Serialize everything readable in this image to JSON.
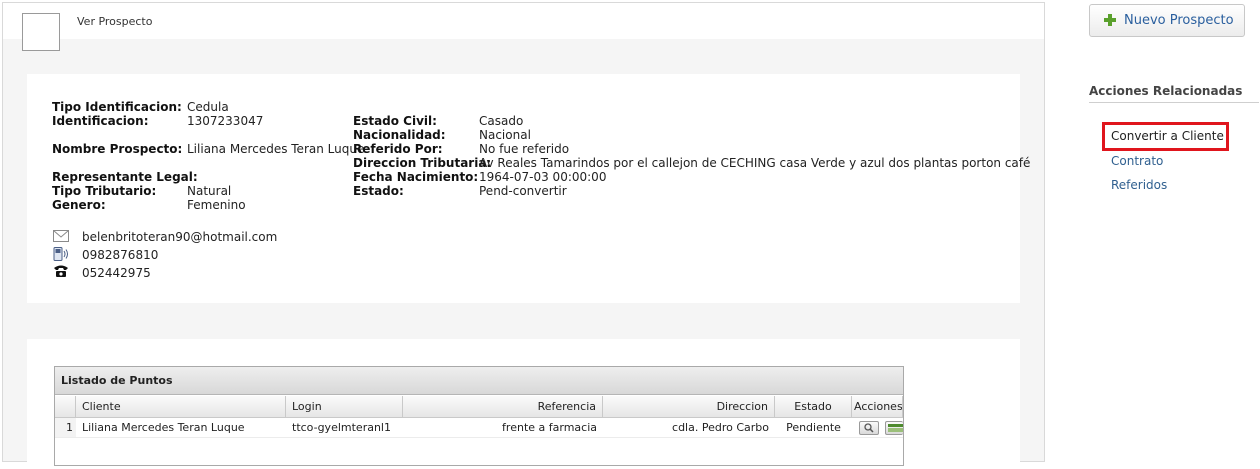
{
  "header": {
    "title": "Ver Prospecto"
  },
  "prospect": {
    "left_fields": [
      {
        "label": "Tipo Identificacion:",
        "value": "Cedula"
      },
      {
        "label": "Identificacion:",
        "value": "1307233047"
      },
      {
        "label": "Nombre Prospecto:",
        "value": "Liliana Mercedes Teran Luque"
      },
      {
        "label": "Representante Legal:",
        "value": ""
      },
      {
        "label": "Tipo Tributario:",
        "value": "Natural"
      },
      {
        "label": "Genero:",
        "value": "Femenino"
      }
    ],
    "right_fields": [
      {
        "label": "Estado Civil:",
        "value": "Casado"
      },
      {
        "label": "Nacionalidad:",
        "value": "Nacional"
      },
      {
        "label": "Referido Por:",
        "value": "No fue referido"
      },
      {
        "label": "Direccion Tributaria:",
        "value": "Av Reales Tamarindos por el callejon de CECHING casa Verde y azul dos plantas porton café"
      },
      {
        "label": "Fecha Nacimiento:",
        "value": "1964-07-03 00:00:00"
      },
      {
        "label": "Estado:",
        "value": "Pend-convertir"
      }
    ],
    "contacts": {
      "email": "belenbritoteran90@hotmail.com",
      "mobile": "0982876810",
      "phone": "052442975"
    }
  },
  "grid": {
    "title": "Listado de Puntos",
    "columns": [
      "Cliente",
      "Login",
      "Referencia",
      "Direccion",
      "Estado",
      "Acciones"
    ],
    "rows": [
      {
        "num": "1",
        "cliente": "Liliana Mercedes Teran Luque",
        "login": "ttco-gyelmteranl1",
        "referencia": "frente a farmacia",
        "direccion": "cdla. Pedro Carbo",
        "estado": "Pendiente"
      }
    ]
  },
  "sidebar": {
    "new_button": "Nuevo Prospecto",
    "related_title": "Acciones Relacionadas",
    "links": [
      "Convertir a Cliente",
      "Contrato",
      "Referidos"
    ]
  },
  "icons": {
    "new": "plus-icon",
    "email": "envelope-icon",
    "mobile": "mobile-phone-icon",
    "phone": "telephone-icon",
    "search": "magnifier-icon",
    "grid_action": "grid-icon"
  },
  "colors": {
    "link": "#2f5f8f",
    "plus": "#5aa02c",
    "highlight": "#e0151d"
  }
}
